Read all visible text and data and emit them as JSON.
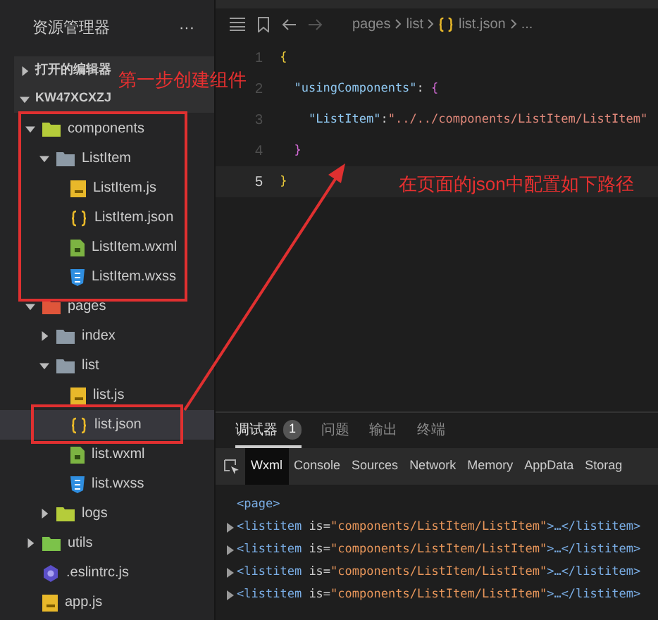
{
  "sidebar": {
    "title": "资源管理器",
    "more": "···",
    "sections": [
      {
        "label": "打开的编辑器",
        "expanded": false
      },
      {
        "label": "KW47XCXZJ",
        "expanded": true
      }
    ],
    "tree": [
      {
        "label": "components",
        "kind": "folder",
        "color": "#b5cc3a",
        "expanded": true,
        "selected": false,
        "children": [
          {
            "label": "ListItem",
            "kind": "folder",
            "color": "#8d9aa6",
            "expanded": true,
            "selected": false,
            "children": [
              {
                "label": "ListItem.js",
                "kind": "js",
                "selected": false
              },
              {
                "label": "ListItem.json",
                "kind": "json",
                "selected": false
              },
              {
                "label": "ListItem.wxml",
                "kind": "wxml",
                "selected": false
              },
              {
                "label": "ListItem.wxss",
                "kind": "wxss",
                "selected": false
              }
            ]
          }
        ]
      },
      {
        "label": "pages",
        "kind": "folder",
        "color": "#e0553a",
        "expanded": true,
        "selected": false,
        "children": [
          {
            "label": "index",
            "kind": "folder",
            "color": "#8d9aa6",
            "expanded": false,
            "selected": false
          },
          {
            "label": "list",
            "kind": "folder",
            "color": "#8d9aa6",
            "expanded": true,
            "selected": false,
            "children": [
              {
                "label": "list.js",
                "kind": "js",
                "selected": false
              },
              {
                "label": "list.json",
                "kind": "json",
                "selected": true
              },
              {
                "label": "list.wxml",
                "kind": "wxml",
                "selected": false
              },
              {
                "label": "list.wxss",
                "kind": "wxss",
                "selected": false
              }
            ]
          },
          {
            "label": "logs",
            "kind": "folder",
            "color": "#b5cc3a",
            "expanded": false,
            "selected": false
          }
        ]
      },
      {
        "label": "utils",
        "kind": "folder",
        "color": "#7cc24a",
        "expanded": false,
        "selected": false
      },
      {
        "label": ".eslintrc.js",
        "kind": "eslint",
        "selected": false
      },
      {
        "label": "app.js",
        "kind": "js",
        "selected": false
      }
    ]
  },
  "editor": {
    "breadcrumb": [
      "pages",
      "list",
      "list.json",
      "..."
    ],
    "lines": [
      {
        "number": "1",
        "active": false,
        "segments": [
          {
            "text": "{",
            "kind": "bracket"
          }
        ]
      },
      {
        "number": "2",
        "active": false,
        "segments": [
          {
            "text": "  \"usingComponents\"",
            "kind": "key"
          },
          {
            "text": ": ",
            "kind": "punct"
          },
          {
            "text": "{",
            "kind": "bracket2"
          }
        ]
      },
      {
        "number": "3",
        "active": false,
        "segments": [
          {
            "text": "    \"ListItem\"",
            "kind": "key"
          },
          {
            "text": ":",
            "kind": "punct"
          },
          {
            "text": "\"../../components/ListItem/ListItem\"",
            "kind": "string"
          }
        ]
      },
      {
        "number": "4",
        "active": false,
        "segments": [
          {
            "text": "  }",
            "kind": "bracket2"
          }
        ]
      },
      {
        "number": "5",
        "active": true,
        "segments": [
          {
            "text": "}",
            "kind": "bracket"
          }
        ]
      }
    ]
  },
  "debug": {
    "tabs": [
      {
        "label": "调试器",
        "badge": "1",
        "selected": true
      },
      {
        "label": "问题",
        "selected": false
      },
      {
        "label": "输出",
        "selected": false
      },
      {
        "label": "终端",
        "selected": false
      }
    ],
    "devtools_tabs": [
      {
        "label": "Wxml",
        "selected": true
      },
      {
        "label": "Console",
        "selected": false
      },
      {
        "label": "Sources",
        "selected": false
      },
      {
        "label": "Network",
        "selected": false
      },
      {
        "label": "Memory",
        "selected": false
      },
      {
        "label": "AppData",
        "selected": false
      },
      {
        "label": "Storag",
        "selected": false
      }
    ],
    "dom": [
      {
        "collapsible": false,
        "segments": [
          {
            "text": "<page>",
            "kind": "tag"
          }
        ]
      },
      {
        "collapsible": true,
        "segments": [
          {
            "text": "<listitem ",
            "kind": "tag"
          },
          {
            "text": "is=",
            "kind": "attr"
          },
          {
            "text": "\"components/ListItem/ListItem\"",
            "kind": "string"
          },
          {
            "text": ">…</listitem>",
            "kind": "tag"
          }
        ]
      },
      {
        "collapsible": true,
        "segments": [
          {
            "text": "<listitem ",
            "kind": "tag"
          },
          {
            "text": "is=",
            "kind": "attr"
          },
          {
            "text": "\"components/ListItem/ListItem\"",
            "kind": "string"
          },
          {
            "text": ">…</listitem>",
            "kind": "tag"
          }
        ]
      },
      {
        "collapsible": true,
        "segments": [
          {
            "text": "<listitem ",
            "kind": "tag"
          },
          {
            "text": "is=",
            "kind": "attr"
          },
          {
            "text": "\"components/ListItem/ListItem\"",
            "kind": "string"
          },
          {
            "text": ">…</listitem>",
            "kind": "tag"
          }
        ]
      },
      {
        "collapsible": true,
        "segments": [
          {
            "text": "<listitem ",
            "kind": "tag"
          },
          {
            "text": "is=",
            "kind": "attr"
          },
          {
            "text": "\"components/ListItem/ListItem\"",
            "kind": "string"
          },
          {
            "text": ">…</listitem>",
            "kind": "tag"
          }
        ]
      }
    ]
  },
  "annotations": [
    {
      "text": "第一步创建组件"
    },
    {
      "text": "在页面的json中配置如下路径"
    }
  ]
}
